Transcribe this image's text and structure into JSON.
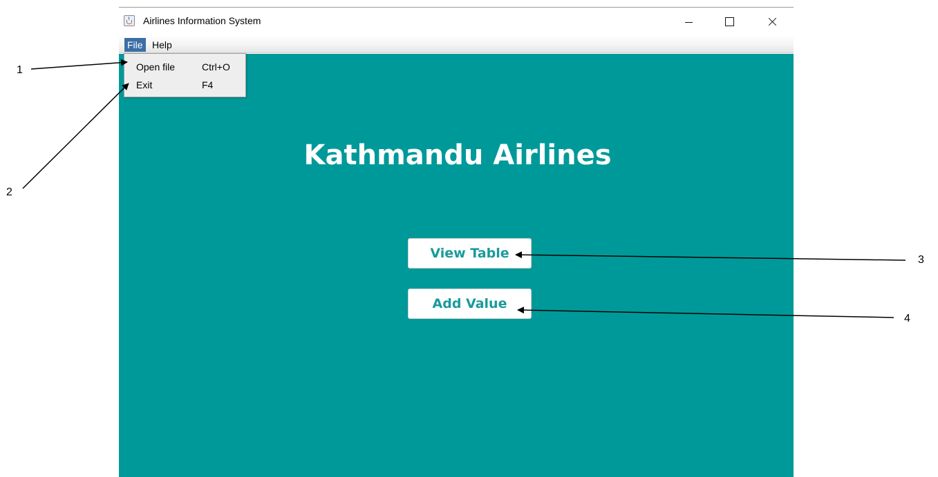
{
  "window": {
    "title": "Airlines Information System"
  },
  "menubar": {
    "items": [
      {
        "label": "File"
      },
      {
        "label": "Help"
      }
    ]
  },
  "file_menu": {
    "items": [
      {
        "label": "Open file",
        "accelerator": "Ctrl+O"
      },
      {
        "label": "Exit",
        "accelerator": "F4"
      }
    ]
  },
  "main": {
    "heading": "Kathmandu Airlines",
    "buttons": {
      "view_table": "View Table",
      "add_value": "Add Value"
    }
  },
  "callouts": [
    "1",
    "2",
    "3",
    "4"
  ],
  "colors": {
    "background": "#009999",
    "button_text": "#1a9a9a",
    "menu_selected": "#3a6ea5"
  }
}
